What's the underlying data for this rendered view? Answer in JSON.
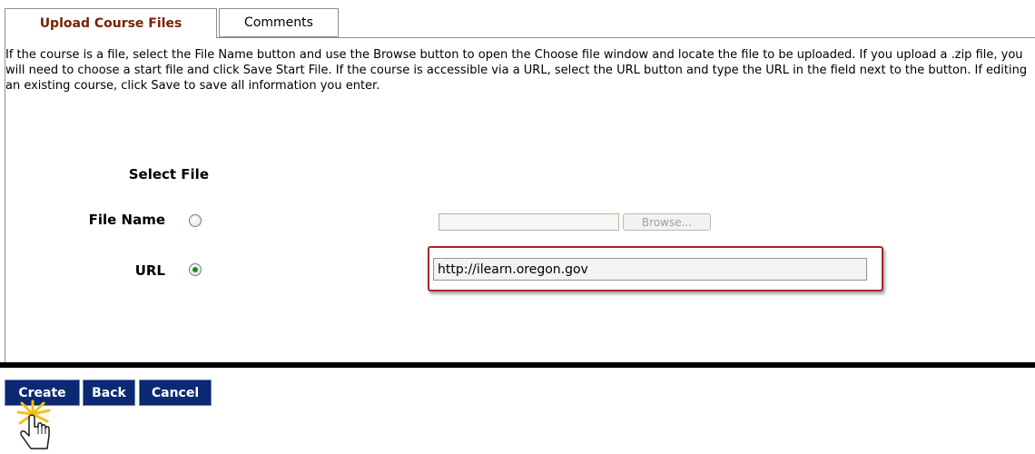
{
  "tabs": {
    "upload_label": "Upload Course Files",
    "comments_label": "Comments"
  },
  "instructions": "If the course is a file, select the File Name button and use the Browse button to open the Choose file window and locate the file to be uploaded. If you upload a .zip file, you will need to choose a start file and click Save Start File. If the course is accessible via a URL, select the URL button and type the URL in the field next to the button. If editing an existing course, click Save to save all information you enter.",
  "form": {
    "select_file_heading": "Select File",
    "file_name_label": "File Name",
    "file_name_selected": false,
    "file_value": "",
    "browse_label": "Browse...",
    "url_label": "URL",
    "url_selected": true,
    "url_value": "http://ilearn.oregon.gov"
  },
  "buttons": {
    "create_label": "Create",
    "back_label": "Back",
    "cancel_label": "Cancel"
  },
  "colors": {
    "active_tab_text": "#7a2100",
    "button_background": "#0c2a73",
    "highlight_border": "#a4242b",
    "radio_checked_dot": "#1d8a17"
  },
  "icons": {
    "radio_selected": "radio-selected-icon",
    "radio_unselected": "radio-unselected-icon",
    "click_cursor": "hand-pointer-click-icon"
  }
}
